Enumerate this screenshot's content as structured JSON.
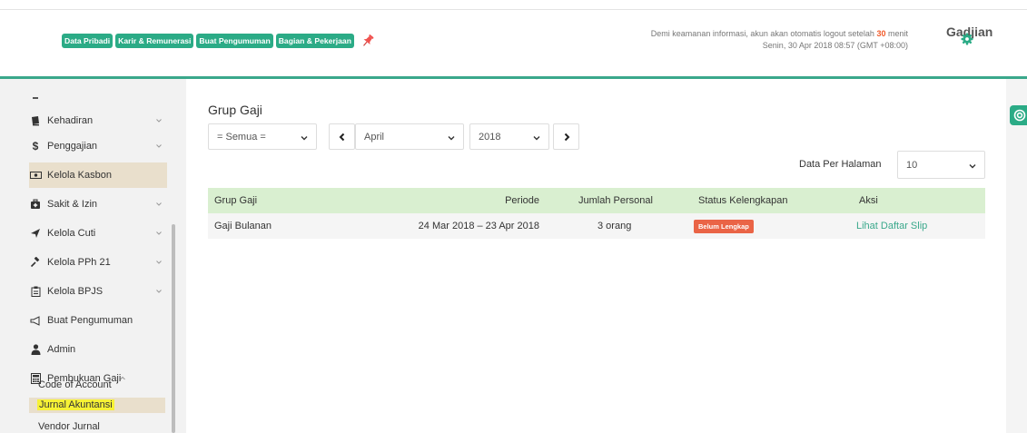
{
  "header": {
    "tabs": [
      {
        "label": "Data Pribadi"
      },
      {
        "label": "Karir & Remunerasi"
      },
      {
        "label": "Buat Pengumuman"
      },
      {
        "label": "Bagian & Pekerjaan"
      }
    ],
    "logout_prefix": "Demi keamanan informasi, akun akan otomatis logout setelah",
    "logout_minutes": "30",
    "logout_suffix": "menit",
    "date": "Senin, 30 Apr 2018 08:57 (GMT +08:00)",
    "brand": "Gadjian"
  },
  "sidebar": {
    "items": [
      {
        "label": "Kehadiran",
        "icon": "book-icon"
      },
      {
        "label": "Penggajian",
        "icon": "dollar-icon"
      },
      {
        "label": "Kelola Kasbon",
        "icon": "cash-icon"
      },
      {
        "label": "Sakit & Izin",
        "icon": "medkit-icon"
      },
      {
        "label": "Kelola Cuti",
        "icon": "plane-icon"
      },
      {
        "label": "Kelola PPh 21",
        "icon": "gavel-icon"
      },
      {
        "label": "Kelola BPJS",
        "icon": "clipboard-icon"
      },
      {
        "label": "Buat Pengumuman",
        "icon": "bullhorn-icon"
      },
      {
        "label": "Admin",
        "icon": "user-icon"
      },
      {
        "label": "Pembukuan Gaji",
        "icon": "calculator-icon"
      }
    ],
    "subitems": [
      {
        "label": "Code of Account"
      },
      {
        "label": "Jurnal Akuntansi"
      },
      {
        "label": "Vendor Jurnal"
      }
    ]
  },
  "main": {
    "title": "Grup Gaji",
    "filter_value": "= Semua =",
    "month_value": "April",
    "year_value": "2018",
    "per_page_label": "Data Per Halaman",
    "per_page_value": "10",
    "table": {
      "headers": [
        "Grup Gaji",
        "Periode",
        "Jumlah Personal",
        "Status Kelengkapan",
        "Aksi"
      ],
      "rows": [
        {
          "group": "Gaji Bulanan",
          "period": "24 Mar 2018 – 23 Apr 2018",
          "count": "3 orang",
          "status": "Belum Lengkap",
          "action": "Lihat Daftar Slip"
        }
      ]
    }
  },
  "colors": {
    "accent": "#2bab86",
    "highlight": "#f7f236",
    "badge": "#ea6446",
    "table_header": "#d9efd0"
  }
}
